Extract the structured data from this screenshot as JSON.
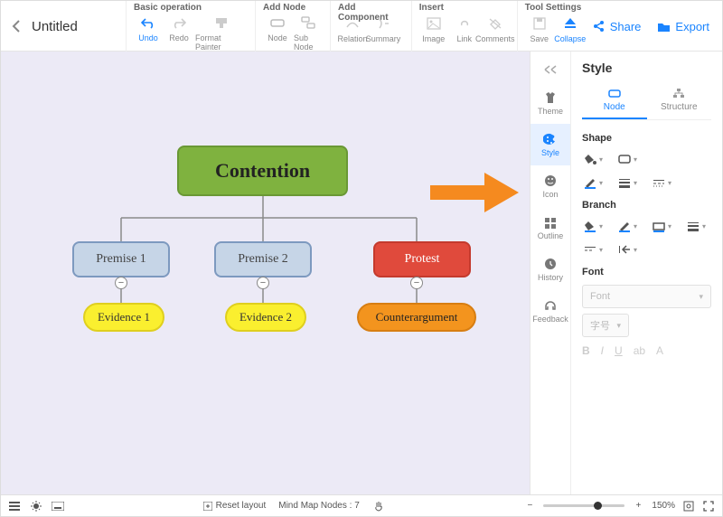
{
  "title": "Untitled",
  "ribbon": {
    "basic": {
      "label": "Basic operation",
      "undo": "Undo",
      "redo": "Redo",
      "format": "Format Painter"
    },
    "addnode": {
      "label": "Add Node",
      "node": "Node",
      "subnode": "Sub Node"
    },
    "addcomp": {
      "label": "Add Component",
      "relation": "Relation",
      "summary": "Summary"
    },
    "insert": {
      "label": "Insert",
      "image": "Image",
      "link": "Link",
      "comments": "Comments"
    },
    "tools": {
      "label": "Tool Settings",
      "save": "Save",
      "collapse": "Collapse"
    }
  },
  "actions": {
    "share": "Share",
    "export": "Export"
  },
  "nodes": {
    "root": "Contention",
    "c1": "Premise 1",
    "c2": "Premise 2",
    "c3": "Protest",
    "l1": "Evidence 1",
    "l2": "Evidence 2",
    "l3": "Counterargument"
  },
  "side": {
    "theme": "Theme",
    "style": "Style",
    "icon": "Icon",
    "outline": "Outline",
    "history": "History",
    "feedback": "Feedback"
  },
  "style": {
    "title": "Style",
    "node": "Node",
    "structure": "Structure",
    "shape": "Shape",
    "branch": "Branch",
    "font": "Font",
    "fontph": "Font",
    "sizeph": "字号"
  },
  "status": {
    "reset": "Reset layout",
    "nodes_label": "Mind Map Nodes :",
    "nodes_count": "7",
    "zoom": "150%"
  }
}
